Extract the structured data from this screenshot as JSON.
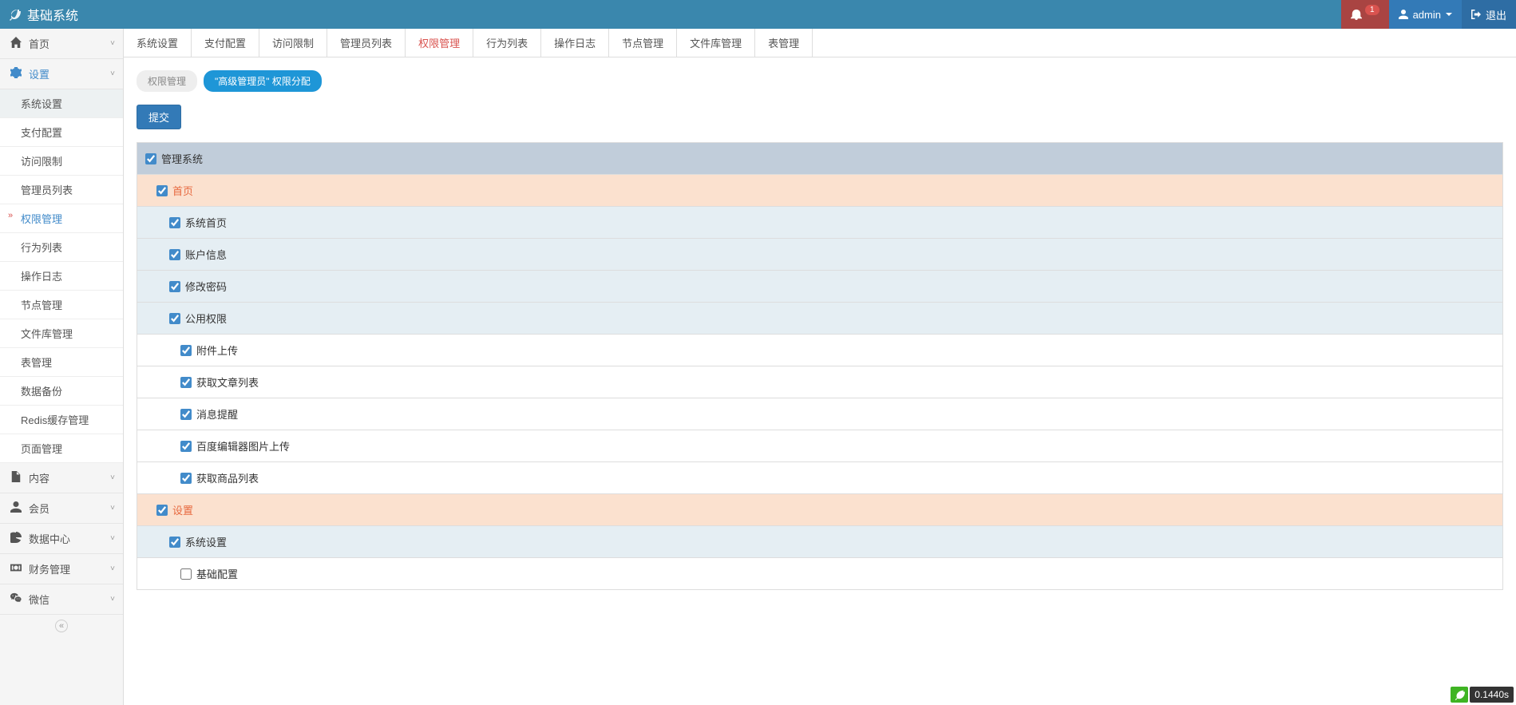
{
  "header": {
    "brand": "基础系统",
    "notif_count": "1",
    "admin_label": "admin",
    "logout_label": "退出"
  },
  "sidebar": {
    "groups": [
      {
        "icon": "home",
        "label": "首页",
        "expanded": false,
        "items": []
      },
      {
        "icon": "gear",
        "label": "设置",
        "expanded": true,
        "active": true,
        "items": [
          {
            "label": "系统设置",
            "sel": true
          },
          {
            "label": "支付配置"
          },
          {
            "label": "访问限制"
          },
          {
            "label": "管理员列表"
          },
          {
            "label": "权限管理",
            "active": true
          },
          {
            "label": "行为列表"
          },
          {
            "label": "操作日志"
          },
          {
            "label": "节点管理"
          },
          {
            "label": "文件库管理"
          },
          {
            "label": "表管理"
          },
          {
            "label": "数据备份"
          },
          {
            "label": "Redis缓存管理"
          },
          {
            "label": "页面管理"
          }
        ]
      },
      {
        "icon": "file",
        "label": "内容",
        "expanded": false
      },
      {
        "icon": "user",
        "label": "会员",
        "expanded": false
      },
      {
        "icon": "pie",
        "label": "数据中心",
        "expanded": false
      },
      {
        "icon": "money",
        "label": "财务管理",
        "expanded": false
      },
      {
        "icon": "wechat",
        "label": "微信",
        "expanded": false
      }
    ]
  },
  "tabs": [
    {
      "label": "系统设置"
    },
    {
      "label": "支付配置"
    },
    {
      "label": "访问限制"
    },
    {
      "label": "管理员列表"
    },
    {
      "label": "权限管理",
      "active": true
    },
    {
      "label": "行为列表"
    },
    {
      "label": "操作日志"
    },
    {
      "label": "节点管理"
    },
    {
      "label": "文件库管理"
    },
    {
      "label": "表管理"
    }
  ],
  "breadcrumb": [
    {
      "label": "权限管理"
    },
    {
      "label": "\"高级管理员\" 权限分配",
      "active": true
    }
  ],
  "submit_label": "提交",
  "perms": [
    {
      "depth": 0,
      "label": "管理系统",
      "checked": true
    },
    {
      "depth": 1,
      "label": "首页",
      "checked": true,
      "orange": true
    },
    {
      "depth": 2,
      "label": "系统首页",
      "checked": true
    },
    {
      "depth": 2,
      "label": "账户信息",
      "checked": true
    },
    {
      "depth": 2,
      "label": "修改密码",
      "checked": true
    },
    {
      "depth": 2,
      "label": "公用权限",
      "checked": true
    },
    {
      "depth": 3,
      "label": "附件上传",
      "checked": true
    },
    {
      "depth": 3,
      "label": "获取文章列表",
      "checked": true
    },
    {
      "depth": 3,
      "label": "消息提醒",
      "checked": true
    },
    {
      "depth": 3,
      "label": "百度编辑器图片上传",
      "checked": true
    },
    {
      "depth": 3,
      "label": "获取商品列表",
      "checked": true
    },
    {
      "depth": 1,
      "label": "设置",
      "checked": true,
      "orange": true
    },
    {
      "depth": 2,
      "label": "系统设置",
      "checked": true
    },
    {
      "depth": 3,
      "label": "基础配置",
      "checked": false
    }
  ],
  "debug_time": "0.1440s"
}
